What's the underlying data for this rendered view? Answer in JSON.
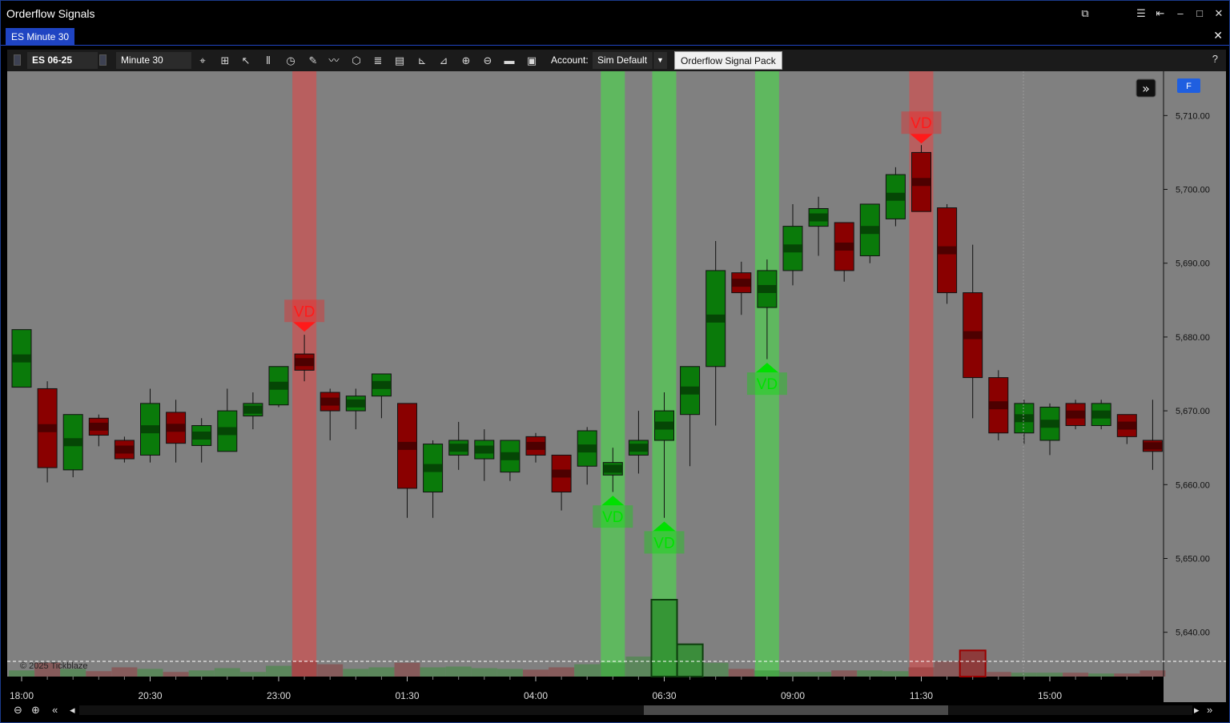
{
  "window": {
    "title": "Orderflow Signals"
  },
  "tabs": [
    {
      "label": "ES Minute 30",
      "active": true
    }
  ],
  "toolbar": {
    "instrument": "ES 06-25",
    "interval": "Minute 30",
    "account_label": "Account:",
    "account_value": "Sim Default",
    "signal_pack": "Orderflow Signal Pack",
    "help": "?"
  },
  "chart": {
    "f_button": "F",
    "copyright": "© 2025 Tickblaze",
    "colors": {
      "background": "#808080",
      "bull": "#0a7a0a",
      "bull_dark": "#053d05",
      "bear": "#8a0000",
      "bear_dark": "#420000",
      "signal_buy": "#00e000",
      "signal_sell": "#ff1a1a",
      "highlight_buy": "#5fb85f",
      "highlight_sell": "#b85f5f"
    }
  },
  "chart_data": {
    "type": "candlestick",
    "y_ticks": [
      "5,710.00",
      "5,700.00",
      "5,690.00",
      "5,680.00",
      "5,670.00",
      "5,660.00",
      "5,650.00",
      "5,640.00"
    ],
    "x_ticks": [
      "18:00",
      "20:30",
      "23:00",
      "01:30",
      "04:00",
      "06:30",
      "09:00",
      "11:30",
      "15:00"
    ],
    "ylim": [
      5634,
      5716
    ],
    "candles": [
      {
        "o": 5673.2,
        "h": 5681,
        "l": 5673.2,
        "c": 5681
      },
      {
        "o": 5673,
        "h": 5674,
        "l": 5660.3,
        "c": 5662.3
      },
      {
        "o": 5662,
        "h": 5669.5,
        "l": 5661,
        "c": 5669.5
      },
      {
        "o": 5669,
        "h": 5669.5,
        "l": 5665.2,
        "c": 5666.7
      },
      {
        "o": 5666,
        "h": 5666.5,
        "l": 5663,
        "c": 5663.5
      },
      {
        "o": 5664,
        "h": 5673,
        "l": 5663,
        "c": 5671
      },
      {
        "o": 5669.8,
        "h": 5671.5,
        "l": 5663,
        "c": 5665.6
      },
      {
        "o": 5665.3,
        "h": 5669,
        "l": 5663,
        "c": 5668
      },
      {
        "o": 5664.5,
        "h": 5673,
        "l": 5664.5,
        "c": 5670
      },
      {
        "o": 5669.3,
        "h": 5672.5,
        "l": 5667.5,
        "c": 5671
      },
      {
        "o": 5670.8,
        "h": 5676,
        "l": 5670.5,
        "c": 5676
      },
      {
        "o": 5677.7,
        "h": 5680.3,
        "l": 5674,
        "c": 5675.5
      },
      {
        "o": 5672.5,
        "h": 5673,
        "l": 5666,
        "c": 5670
      },
      {
        "o": 5670,
        "h": 5673,
        "l": 5667.5,
        "c": 5672
      },
      {
        "o": 5672,
        "h": 5675,
        "l": 5669,
        "c": 5675
      },
      {
        "o": 5671,
        "h": 5671,
        "l": 5655.5,
        "c": 5659.5
      },
      {
        "o": 5659,
        "h": 5666,
        "l": 5655.5,
        "c": 5665.5
      },
      {
        "o": 5664,
        "h": 5668.5,
        "l": 5662,
        "c": 5666
      },
      {
        "o": 5663.5,
        "h": 5667.5,
        "l": 5660.5,
        "c": 5666
      },
      {
        "o": 5661.7,
        "h": 5666,
        "l": 5660.5,
        "c": 5666
      },
      {
        "o": 5666.5,
        "h": 5667,
        "l": 5663,
        "c": 5664
      },
      {
        "o": 5664,
        "h": 5661,
        "l": 5656.5,
        "c": 5659
      },
      {
        "o": 5662.5,
        "h": 5667.8,
        "l": 5660,
        "c": 5667.3
      },
      {
        "o": 5661.3,
        "h": 5665,
        "l": 5659,
        "c": 5663
      },
      {
        "o": 5664,
        "h": 5670,
        "l": 5661.5,
        "c": 5666
      },
      {
        "o": 5666,
        "h": 5672.5,
        "l": 5655.5,
        "c": 5670
      },
      {
        "o": 5669.5,
        "h": 5676,
        "l": 5662.5,
        "c": 5676
      },
      {
        "o": 5676,
        "h": 5693,
        "l": 5668,
        "c": 5689
      },
      {
        "o": 5688.7,
        "h": 5690.2,
        "l": 5683,
        "c": 5686
      },
      {
        "o": 5684,
        "h": 5690.5,
        "l": 5677,
        "c": 5689
      },
      {
        "o": 5689,
        "h": 5698,
        "l": 5687,
        "c": 5695
      },
      {
        "o": 5695,
        "h": 5699,
        "l": 5691,
        "c": 5697.4
      },
      {
        "o": 5695.5,
        "h": 5695.5,
        "l": 5687.5,
        "c": 5689
      },
      {
        "o": 5691,
        "h": 5698,
        "l": 5690,
        "c": 5698
      },
      {
        "o": 5696,
        "h": 5703,
        "l": 5695,
        "c": 5702
      },
      {
        "o": 5705,
        "h": 5706,
        "l": 5697,
        "c": 5697
      },
      {
        "o": 5697.5,
        "h": 5698,
        "l": 5684.5,
        "c": 5686
      },
      {
        "o": 5686,
        "h": 5692.5,
        "l": 5669,
        "c": 5674.5
      },
      {
        "o": 5674.5,
        "h": 5675.5,
        "l": 5666,
        "c": 5667
      },
      {
        "o": 5667,
        "h": 5671.5,
        "l": 5665.5,
        "c": 5671
      },
      {
        "o": 5666,
        "h": 5671,
        "l": 5664,
        "c": 5670.5
      },
      {
        "o": 5671,
        "h": 5671.5,
        "l": 5667.5,
        "c": 5668
      },
      {
        "o": 5668,
        "h": 5671.5,
        "l": 5667.5,
        "c": 5671
      },
      {
        "o": 5669.5,
        "h": 5669.5,
        "l": 5665.5,
        "c": 5666.5
      },
      {
        "o": 5666,
        "h": 5671.5,
        "l": 5662,
        "c": 5664.5
      }
    ],
    "signals": [
      {
        "index": 11,
        "direction": "sell",
        "label": "VD",
        "price": 5680.5
      },
      {
        "index": 23,
        "direction": "buy",
        "label": "VD",
        "price": 5658.5
      },
      {
        "index": 25,
        "direction": "buy",
        "label": "VD",
        "price": 5655
      },
      {
        "index": 29,
        "direction": "buy",
        "label": "VD",
        "price": 5676.5
      },
      {
        "index": 35,
        "direction": "sell",
        "label": "VD",
        "price": 5706
      }
    ],
    "volume": [
      0.08,
      0.18,
      0.1,
      0.07,
      0.12,
      0.1,
      0.06,
      0.08,
      0.11,
      0.06,
      0.14,
      0.2,
      0.16,
      0.1,
      0.12,
      0.18,
      0.12,
      0.13,
      0.11,
      0.1,
      0.09,
      0.12,
      0.16,
      0.18,
      0.26,
      1.0,
      0.42,
      0.18,
      0.1,
      0.08,
      0.06,
      0.06,
      0.08,
      0.08,
      0.07,
      0.12,
      0.2,
      0.34,
      0.06,
      0.05,
      0.05,
      0.05,
      0.04,
      0.04,
      0.08
    ]
  }
}
